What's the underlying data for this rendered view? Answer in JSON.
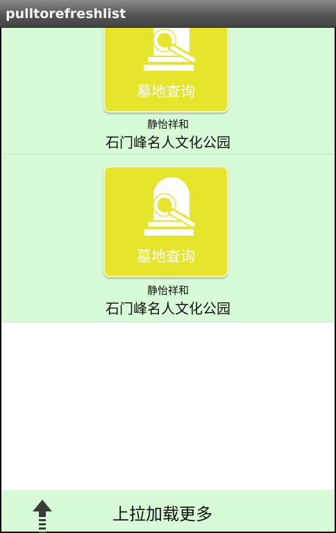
{
  "app": {
    "title": "pulltorefreshlist"
  },
  "list": {
    "items": [
      {
        "tile_label": "墓地查询",
        "icon": "tombstone-search-icon",
        "slogan": "静怡祥和",
        "name": "石门峰名人文化公园"
      },
      {
        "tile_label": "墓地查询",
        "icon": "tombstone-search-icon",
        "slogan": "静怡祥和",
        "name": "石门峰名人文化公园"
      }
    ]
  },
  "footer": {
    "label": "上拉加载更多",
    "icon": "up-arrow-icon"
  },
  "colors": {
    "item_background": "#d7fbd7",
    "tile_background": "#e5e52b",
    "titlebar": "#555555"
  }
}
